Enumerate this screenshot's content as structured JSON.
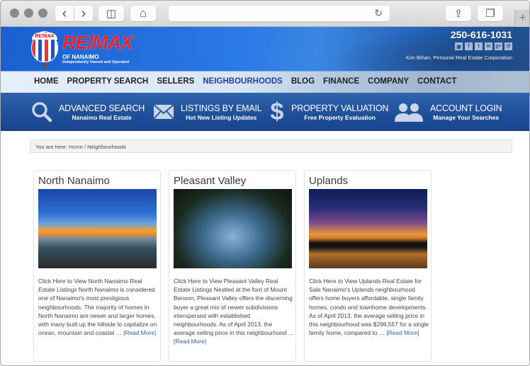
{
  "browser": {
    "back_icon": "‹",
    "forward_icon": "›",
    "sidebar_icon": "◫",
    "home_icon": "⌂",
    "reload_icon": "↻",
    "share_icon": "⇪",
    "tabs_icon": "❐",
    "newtab_icon": "+",
    "url_value": ""
  },
  "header": {
    "logo_balloon_text": "RE/MAX",
    "logo_text": "RE/MAX",
    "logo_sub1": "OF NANAIMO",
    "logo_sub2": "Independently Owned and Operated",
    "phone": "250-616-1031",
    "socials": [
      {
        "name": "youtube",
        "glyph": "▣"
      },
      {
        "name": "facebook",
        "glyph": "f"
      },
      {
        "name": "twitter",
        "glyph": "t"
      },
      {
        "name": "linkedin",
        "glyph": "in"
      },
      {
        "name": "googleplus",
        "glyph": "g+"
      },
      {
        "name": "email",
        "glyph": "@"
      }
    ],
    "agent": "Kim Bihari, Personal Real Estate Corporation"
  },
  "nav": {
    "items": [
      {
        "label": "HOME"
      },
      {
        "label": "PROPERTY SEARCH"
      },
      {
        "label": "SELLERS"
      },
      {
        "label": "NEIGHBOURHOODS",
        "active": true
      },
      {
        "label": "BLOG"
      },
      {
        "label": "FINANCE"
      },
      {
        "label": "COMPANY"
      },
      {
        "label": "CONTACT"
      }
    ]
  },
  "features": [
    {
      "title": "ADVANCED SEARCH",
      "subtitle": "Nanaimo Real Estate",
      "icon": "search-icon"
    },
    {
      "title": "LISTINGS BY EMAIL",
      "subtitle": "Hot New Listing Updates",
      "icon": "envelope-icon"
    },
    {
      "title": "PROPERTY VALUATION",
      "subtitle": "Free Property Evaluation",
      "icon": "dollar-icon"
    },
    {
      "title": "ACCOUNT LOGIN",
      "subtitle": "Manage Your Searches",
      "icon": "users-icon"
    }
  ],
  "breadcrumb": {
    "prefix": "You are here: ",
    "home": "Home",
    "separator": " / ",
    "current": "Neighbourhoods"
  },
  "cards": [
    {
      "title": "North Nanaimo",
      "body": "Click Here to View North Nanaimo Real Estate Listings   North Nanaimo is considered one of Nanaimo's most prestigious neighbourhoods. The majority of homes in North Nanaimo are newer and larger homes, with many built up the hillside to capitalize on ocean, mountain and coastal … ",
      "read_more": "[Read More]"
    },
    {
      "title": "Pleasant Valley",
      "body": "Click Here to View Pleasant Valley Real Estate Listings   Nestled at the foot of Mount Benson, Pleasant Valley offers the discerning buyer a great mix of newer subdivisions interspersed with established neighbourhoods. As of April 2013, the average selling price in this neighbourhood … ",
      "read_more": "[Read More]"
    },
    {
      "title": "Uplands",
      "body": "Click Here to View Uplands Real Estate for Sale   Nanaimo's Uplands neighbourhood offers home buyers affordable, single family homes, condo and townhome developments. As of April 2013, the average selling price in this neighbourhood was $298,557 for a single family home, compared to … ",
      "read_more": "[Read More]"
    }
  ]
}
